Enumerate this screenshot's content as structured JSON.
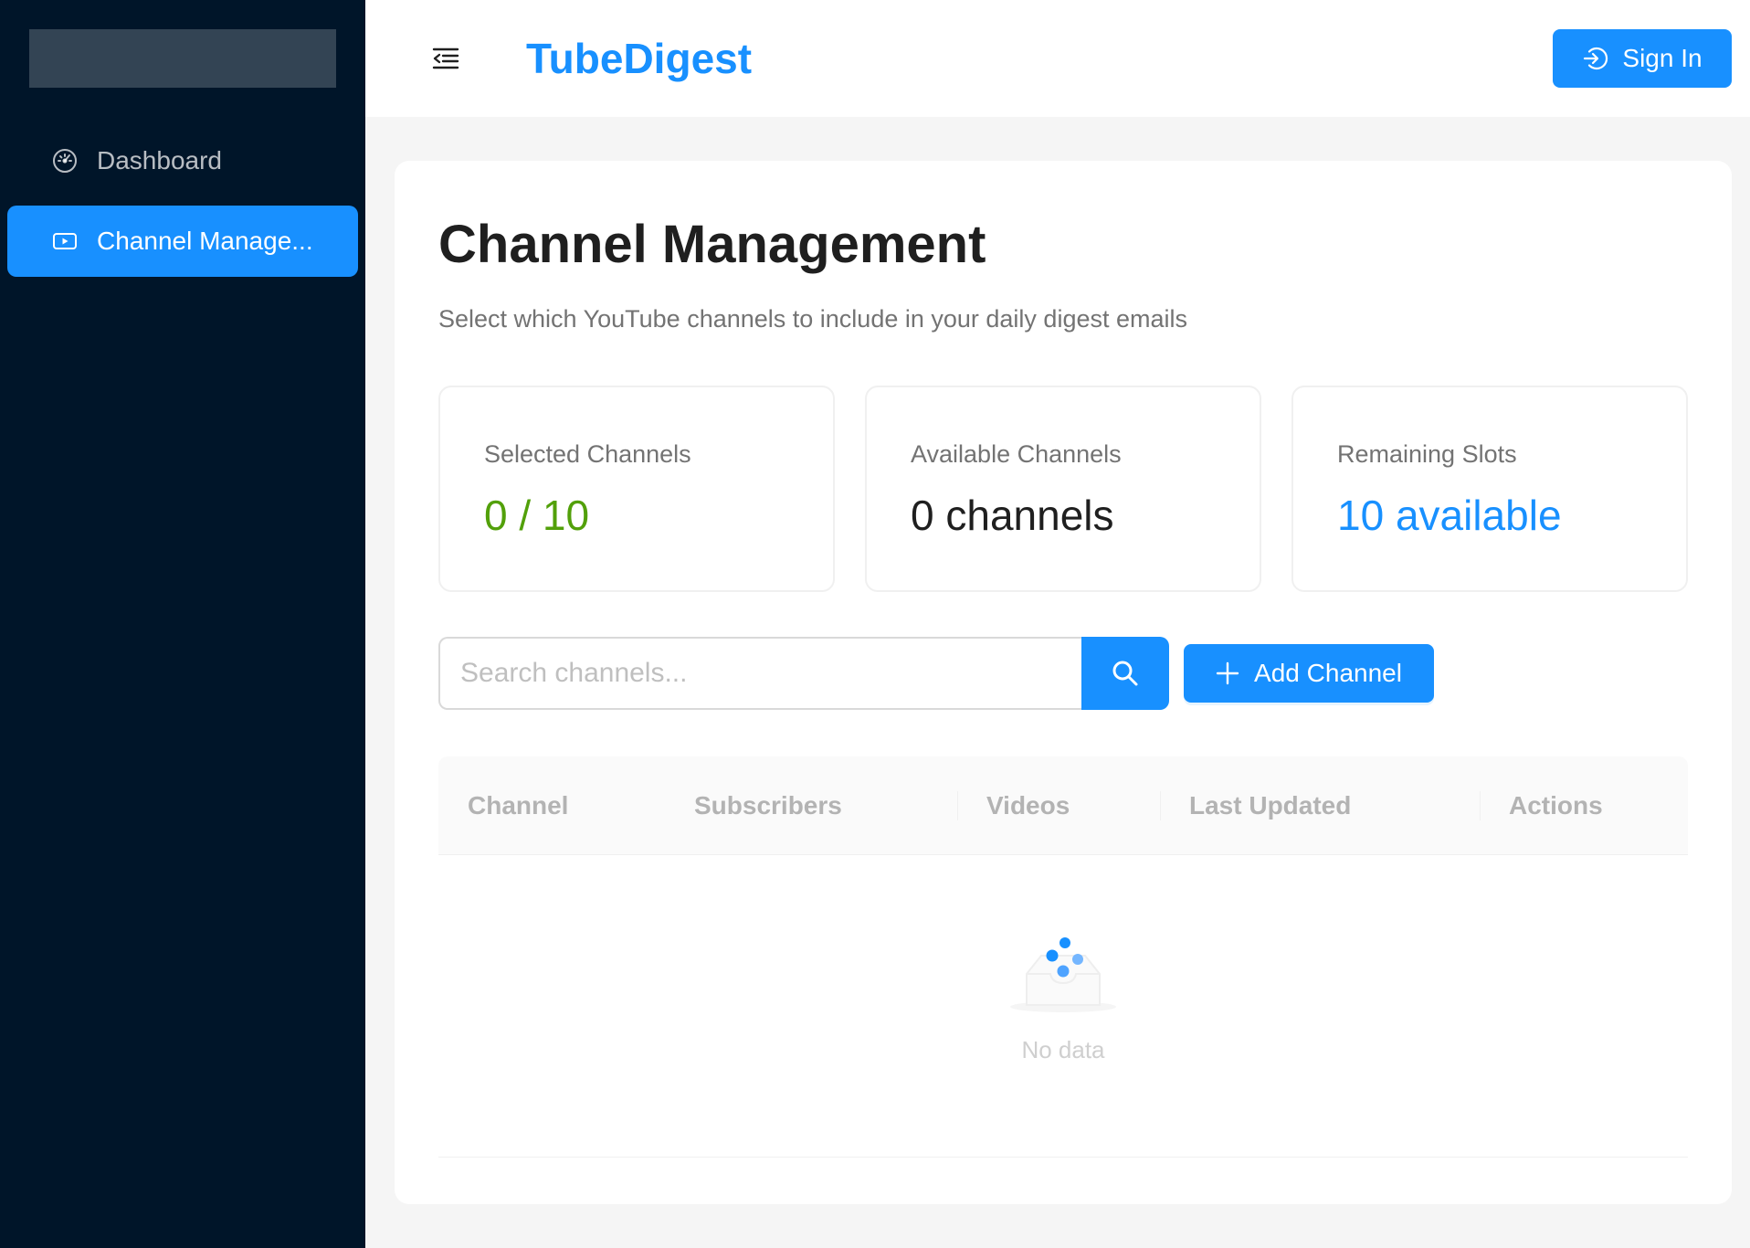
{
  "sidebar": {
    "items": [
      {
        "label": "Dashboard",
        "icon": "dashboard-icon",
        "active": false
      },
      {
        "label": "Channel Manage...",
        "icon": "video-icon",
        "active": true
      }
    ]
  },
  "header": {
    "brand": "TubeDigest",
    "signin_label": "Sign In"
  },
  "main": {
    "title": "Channel Management",
    "subtitle": "Select which YouTube channels to include in your daily digest emails",
    "stats": [
      {
        "label": "Selected Channels",
        "value": "0 / 10",
        "color": "#52a00a"
      },
      {
        "label": "Available Channels",
        "value": "0 channels",
        "color": "#1f1f1f"
      },
      {
        "label": "Remaining Slots",
        "value": "10 available",
        "color": "#1890ff"
      }
    ],
    "search": {
      "placeholder": "Search channels...",
      "value": ""
    },
    "add_label": "Add Channel",
    "table": {
      "columns": [
        "Channel",
        "Subscribers",
        "Videos",
        "Last Updated",
        "Actions"
      ],
      "rows": [],
      "empty_text": "No data"
    }
  },
  "colors": {
    "accent": "#1890ff",
    "sidebar_bg": "#001529"
  }
}
